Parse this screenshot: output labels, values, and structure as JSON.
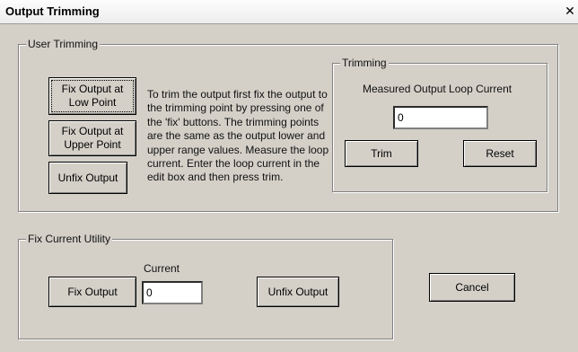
{
  "window": {
    "title": "Output Trimming",
    "close_glyph": "✕"
  },
  "user_trimming": {
    "legend": "User Trimming",
    "fix_low_label": "Fix Output at Low Point",
    "fix_upper_label": "Fix Output at Upper Point",
    "unfix_label": "Unfix Output",
    "instructions": "To trim the output first fix the output to the trimming point by pressing one of the 'fix' buttons. The trimming points are the same as the output lower and upper range values. Measure the loop current. Enter the loop current in the edit box and then press trim."
  },
  "trimming": {
    "legend": "Trimming",
    "measured_label": "Measured Output Loop Current",
    "measured_value": "0",
    "trim_label": "Trim",
    "reset_label": "Reset"
  },
  "fix_current": {
    "legend": "Fix Current Utility",
    "current_label": "Current",
    "current_value": "0",
    "fix_label": "Fix Output",
    "unfix_label": "Unfix Output"
  },
  "cancel_label": "Cancel"
}
